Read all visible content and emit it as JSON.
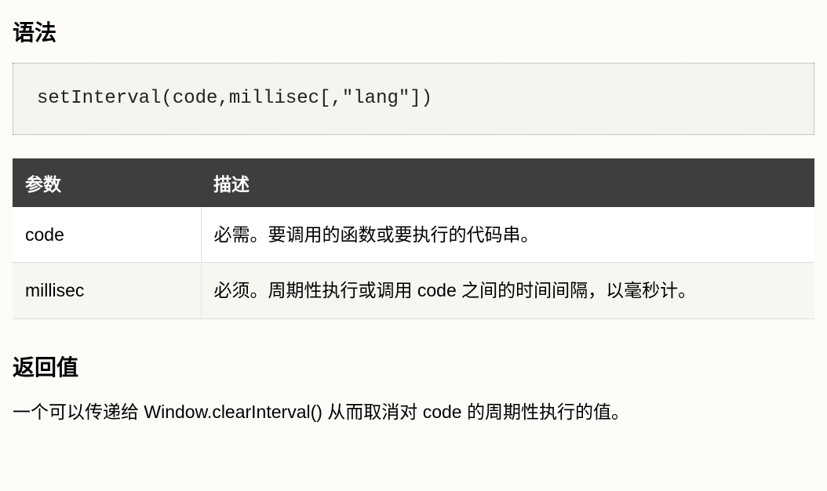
{
  "sections": {
    "syntax": {
      "heading": "语法",
      "code": "setInterval(code,millisec[,\"lang\"])"
    },
    "params": {
      "headers": {
        "name": "参数",
        "description": "描述"
      },
      "rows": [
        {
          "name": "code",
          "description": "必需。要调用的函数或要执行的代码串。"
        },
        {
          "name": "millisec",
          "description": "必须。周期性执行或调用 code 之间的时间间隔，以毫秒计。"
        }
      ]
    },
    "return": {
      "heading": "返回值",
      "text": "一个可以传递给 Window.clearInterval() 从而取消对 code 的周期性执行的值。"
    }
  }
}
